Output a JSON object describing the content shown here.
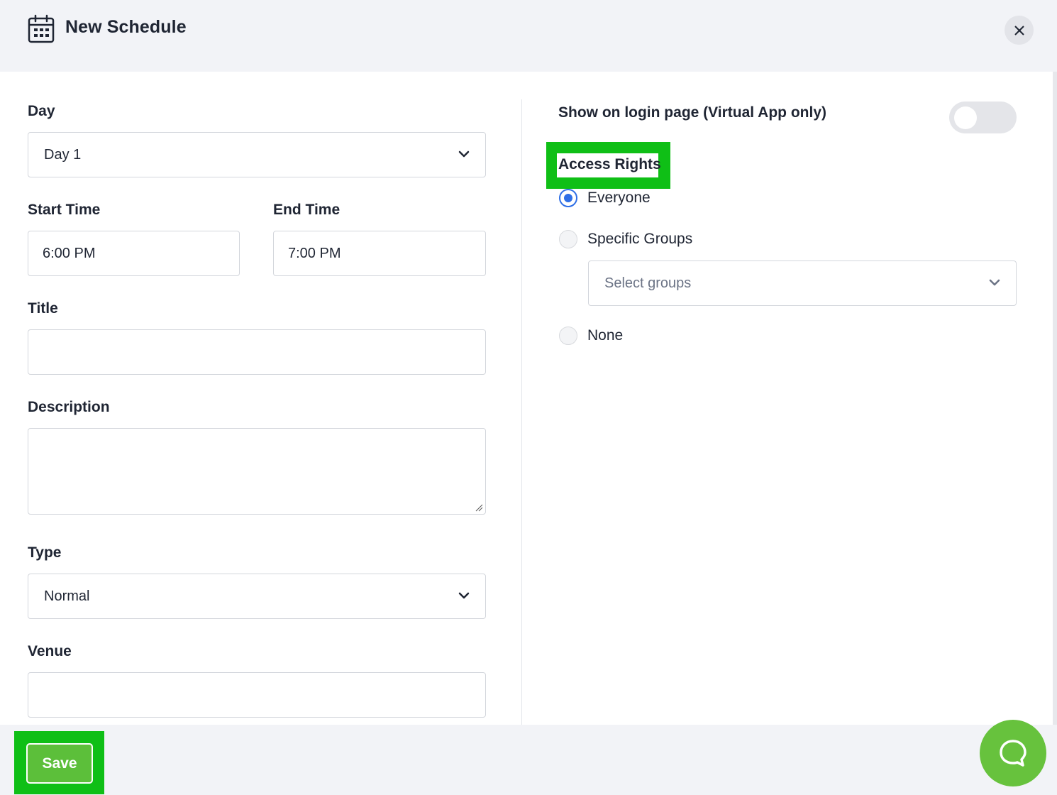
{
  "header": {
    "title": "New Schedule",
    "icon": "calendar-icon",
    "close_icon": "close-icon"
  },
  "form": {
    "day": {
      "label": "Day",
      "value": "Day 1"
    },
    "start_time": {
      "label": "Start Time",
      "value": "6:00 PM"
    },
    "end_time": {
      "label": "End Time",
      "value": "7:00 PM"
    },
    "title": {
      "label": "Title",
      "value": ""
    },
    "description": {
      "label": "Description",
      "value": ""
    },
    "type": {
      "label": "Type",
      "value": "Normal"
    },
    "venue": {
      "label": "Venue",
      "value": ""
    }
  },
  "settings": {
    "show_on_login_label": "Show on login page (Virtual App only)",
    "show_on_login_enabled": false,
    "access_rights": {
      "label": "Access Rights",
      "options": [
        {
          "label": "Everyone",
          "selected": true
        },
        {
          "label": "Specific Groups",
          "selected": false
        },
        {
          "label": "None",
          "selected": false
        }
      ],
      "groups_placeholder": "Select groups"
    }
  },
  "footer": {
    "save_label": "Save",
    "chat_icon": "chat-bubble-icon"
  },
  "colors": {
    "highlight": "#0fbf16",
    "save_button": "#5cbf3a",
    "radio_selected": "#2f6fe6",
    "chat_button": "#67c23d"
  }
}
